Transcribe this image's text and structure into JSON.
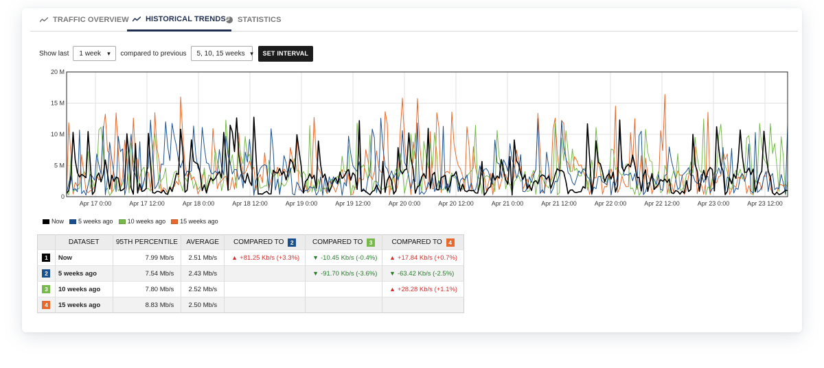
{
  "tabs": [
    {
      "label": "TRAFFIC OVERVIEW",
      "icon": "trend-line-icon",
      "active": false
    },
    {
      "label": "HISTORICAL TRENDS",
      "icon": "trend-line-icon",
      "active": true
    },
    {
      "label": "STATISTICS",
      "icon": "pie-chart-icon",
      "active": false
    }
  ],
  "controls": {
    "show_last_label": "Show last",
    "show_last_value": "1 week",
    "compared_label": "compared to previous",
    "compared_value": "5, 10, 15 weeks",
    "set_interval_label": "SET INTERVAL"
  },
  "chart_data": {
    "type": "line",
    "y_ticks": [
      "0",
      "5 M",
      "10 M",
      "15 M",
      "20 M"
    ],
    "ylim": [
      0,
      20
    ],
    "x_ticks": [
      "Apr 17 0:00",
      "Apr 17 12:00",
      "Apr 18 0:00",
      "Apr 18 12:00",
      "Apr 19 0:00",
      "Apr 19 12:00",
      "Apr 20 0:00",
      "Apr 20 12:00",
      "Apr 21 0:00",
      "Apr 21 12:00",
      "Apr 22 0:00",
      "Apr 22 12:00",
      "Apr 23 0:00",
      "Apr 23 12:00"
    ],
    "series": [
      {
        "name": "Now",
        "color": "#000000",
        "seed": 11,
        "base": 2.5,
        "peak": 12.8,
        "spike_rate": 0.14
      },
      {
        "name": "5 weeks ago",
        "color": "#1a4f8f",
        "seed": 23,
        "base": 2.4,
        "peak": 12.6,
        "spike_rate": 0.16
      },
      {
        "name": "10 weeks ago",
        "color": "#78b94c",
        "seed": 37,
        "base": 2.5,
        "peak": 12.8,
        "spike_rate": 0.15
      },
      {
        "name": "15 weeks ago",
        "color": "#e8692b",
        "seed": 53,
        "base": 2.5,
        "peak": 16.5,
        "spike_rate": 0.15
      }
    ]
  },
  "legend": [
    {
      "label": "Now",
      "color": "#000000"
    },
    {
      "label": "5 weeks ago",
      "color": "#1a4f8f"
    },
    {
      "label": "10 weeks ago",
      "color": "#78b94c"
    },
    {
      "label": "15 weeks ago",
      "color": "#e8692b"
    }
  ],
  "table": {
    "headers": [
      "DATASET",
      "95TH PERCENTILE",
      "AVERAGE",
      "COMPARED TO",
      "COMPARED TO",
      "COMPARED TO"
    ],
    "header_badges": [
      "2",
      "3",
      "4"
    ],
    "rows": [
      {
        "idx": "1",
        "name": "Now",
        "p95": "7.99 Mb/s",
        "avg": "2.51 Mb/s",
        "c2": "+81.25 Kb/s (+3.3%)",
        "c2_dir": "up",
        "c3": "-10.45 Kb/s (-0.4%)",
        "c3_dir": "down",
        "c4": "+17.84 Kb/s (+0.7%)",
        "c4_dir": "up"
      },
      {
        "idx": "2",
        "name": "5 weeks ago",
        "p95": "7.54 Mb/s",
        "avg": "2.43 Mb/s",
        "c2": "",
        "c2_dir": "",
        "c3": "-91.70 Kb/s (-3.6%)",
        "c3_dir": "down",
        "c4": "-63.42 Kb/s (-2.5%)",
        "c4_dir": "down"
      },
      {
        "idx": "3",
        "name": "10 weeks ago",
        "p95": "7.80 Mb/s",
        "avg": "2.52 Mb/s",
        "c2": "",
        "c2_dir": "",
        "c3": "",
        "c3_dir": "",
        "c4": "+28.28 Kb/s (+1.1%)",
        "c4_dir": "up"
      },
      {
        "idx": "4",
        "name": "15 weeks ago",
        "p95": "8.83 Mb/s",
        "avg": "2.50 Mb/s",
        "c2": "",
        "c2_dir": "",
        "c3": "",
        "c3_dir": "",
        "c4": "",
        "c4_dir": ""
      }
    ]
  }
}
